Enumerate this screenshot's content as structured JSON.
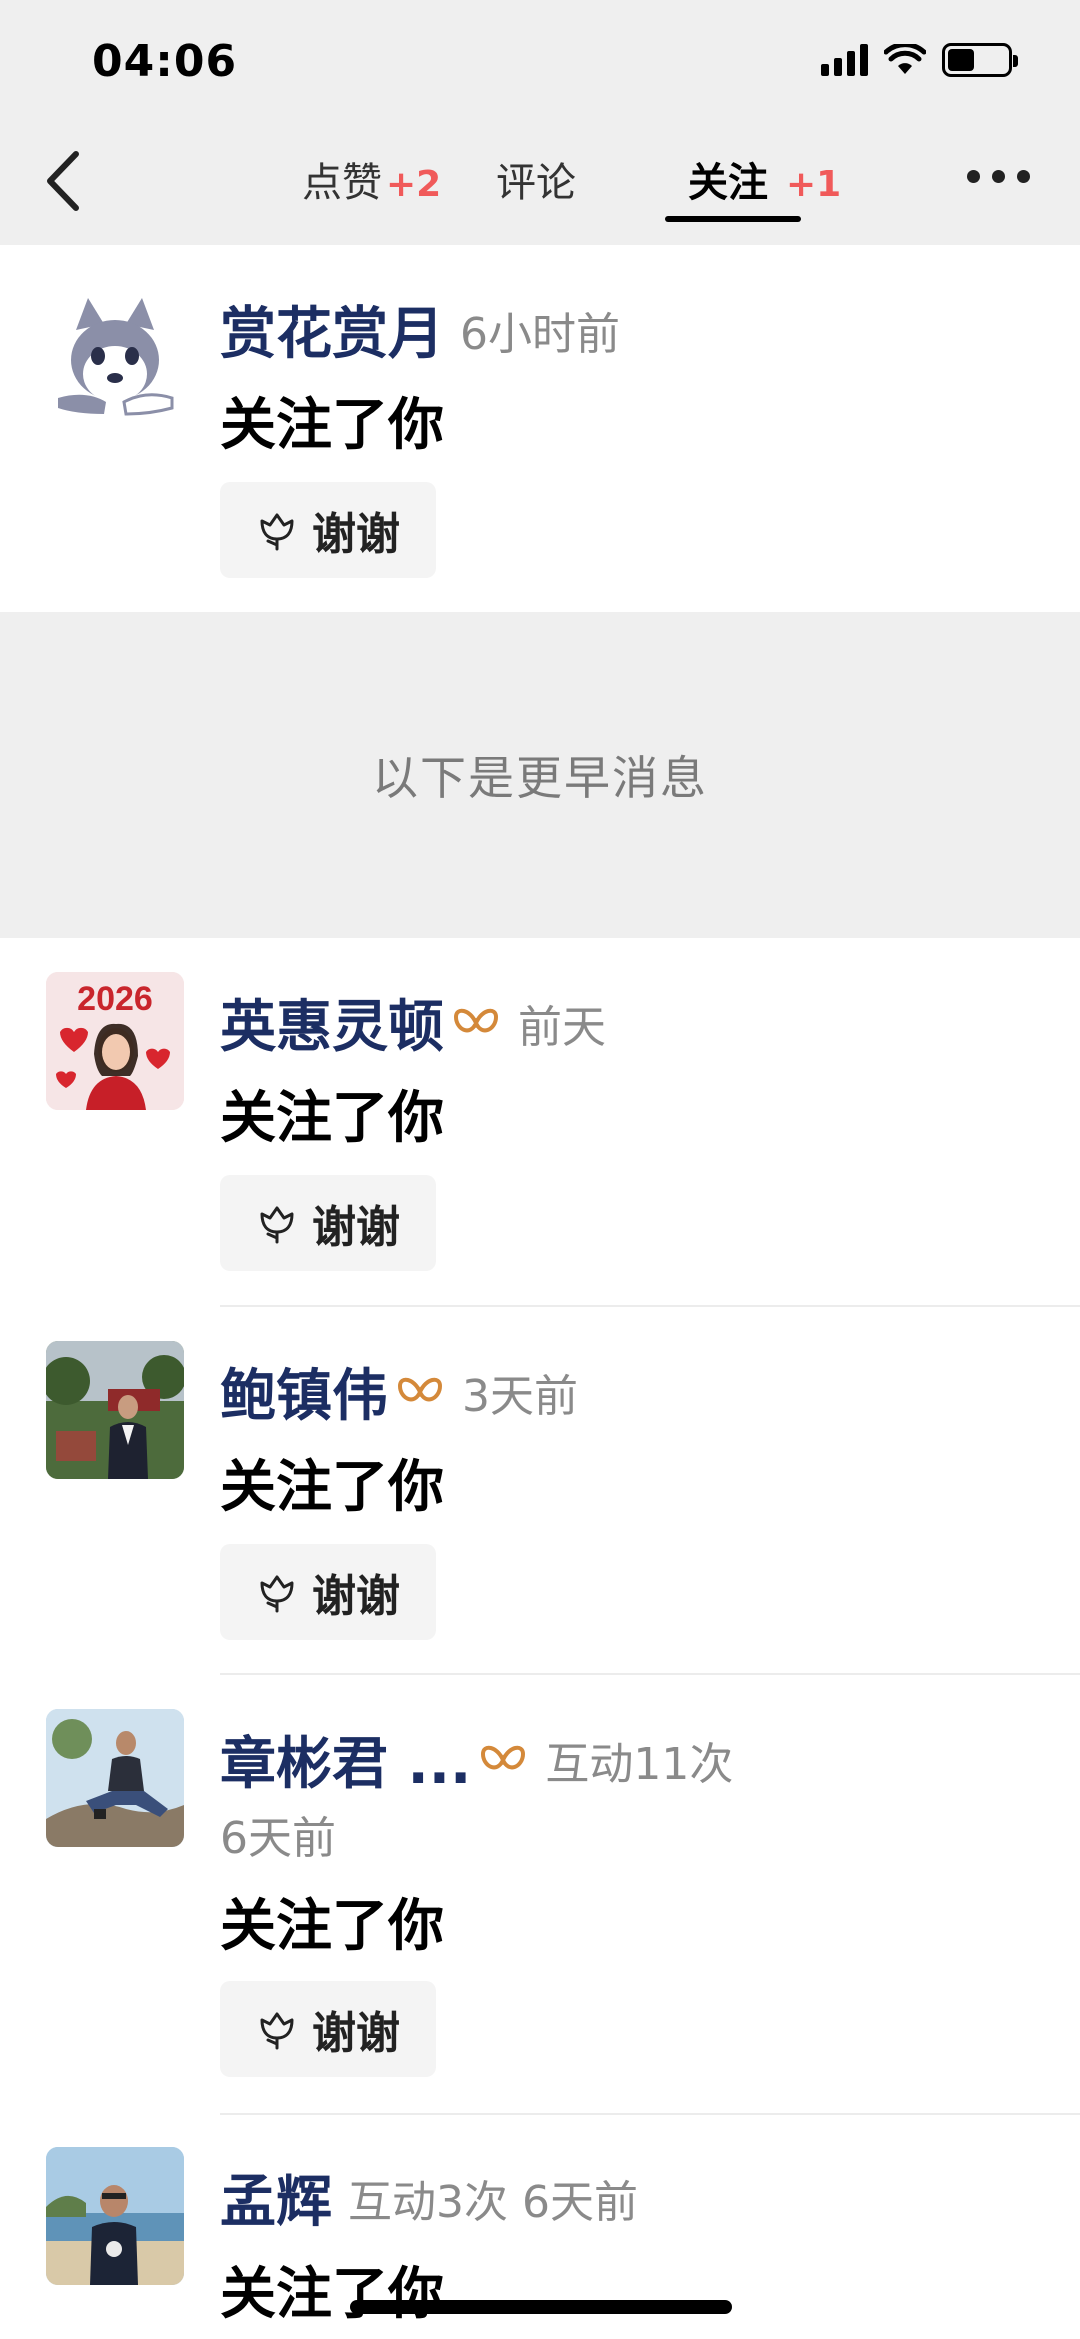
{
  "status_bar": {
    "time": "04:06"
  },
  "header": {
    "tabs": [
      {
        "label": "点赞",
        "badge": "+2"
      },
      {
        "label": "评论",
        "badge": ""
      },
      {
        "label": "关注",
        "badge": "+1"
      }
    ]
  },
  "items_recent": [
    {
      "name": "赏花赏月",
      "meta": "6小时前",
      "action": "关注了你",
      "button": "谢谢"
    }
  ],
  "earlier_label": "以下是更早消息",
  "items_earlier": [
    {
      "name": "英惠灵顿",
      "meta": "前天",
      "action": "关注了你",
      "button": "谢谢"
    },
    {
      "name": "鲍镇伟",
      "meta": "3天前",
      "action": "关注了你",
      "button": "谢谢"
    },
    {
      "name": "章彬君 ...",
      "meta": "互动11次",
      "meta2": "6天前",
      "action": "关注了你",
      "button": "谢谢"
    },
    {
      "name": "孟辉",
      "meta": "互动3次 6天前",
      "action": "关注了你"
    }
  ],
  "avatar_texts": {
    "item2": "2026"
  },
  "colors": {
    "name": "#1c2e63",
    "badge": "#f05a5a",
    "vip": "#d4893a",
    "background_gray": "#efefef"
  }
}
